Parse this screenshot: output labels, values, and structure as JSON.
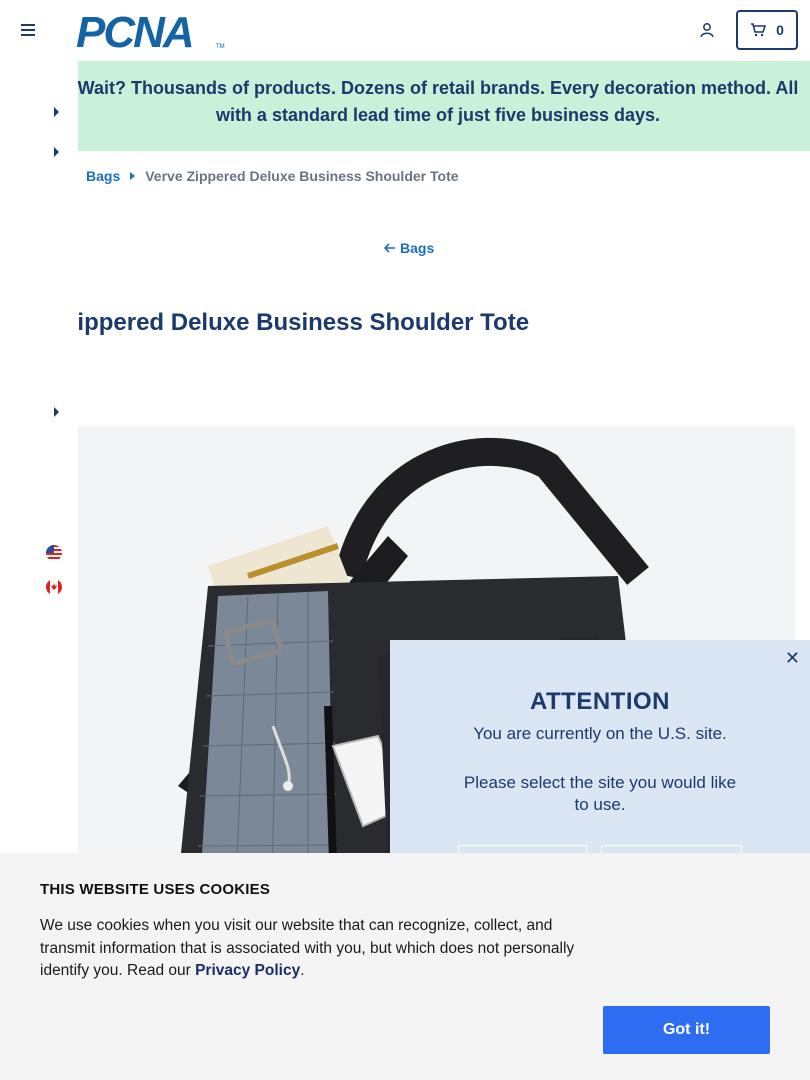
{
  "header": {
    "logo_text": "PCNA",
    "logo_tm": "TM",
    "cart_count": "0"
  },
  "promo": {
    "text": "Wait? Thousands of products. Dozens of retail brands. Every decoration method. All with a standard lead time of just five business days."
  },
  "breadcrumb": {
    "parent": "Bags",
    "current": "Verve Zippered Deluxe Business Shoulder Tote"
  },
  "back_link": {
    "label": "Bags"
  },
  "product": {
    "title": "Verve Zippered Deluxe Business Shoulder Tote"
  },
  "attention": {
    "title": "ATTENTION",
    "line1": "You are currently on the U.S. site.",
    "line2": "Please select the site you would like to use."
  },
  "cookie": {
    "title": "THIS WEBSITE USES COOKIES",
    "body": "We use cookies when you visit our website that can recognize, collect, and transmit information that is associated with you, but which does not personally identify you. Read our ",
    "link": "Privacy Policy",
    "period": ".",
    "button": "Got it!"
  },
  "colors": {
    "brand": "#1463a5",
    "navy": "#1b3a6b",
    "promo_bg": "#c9f0d8",
    "cookie_button": "#2e6df2"
  }
}
